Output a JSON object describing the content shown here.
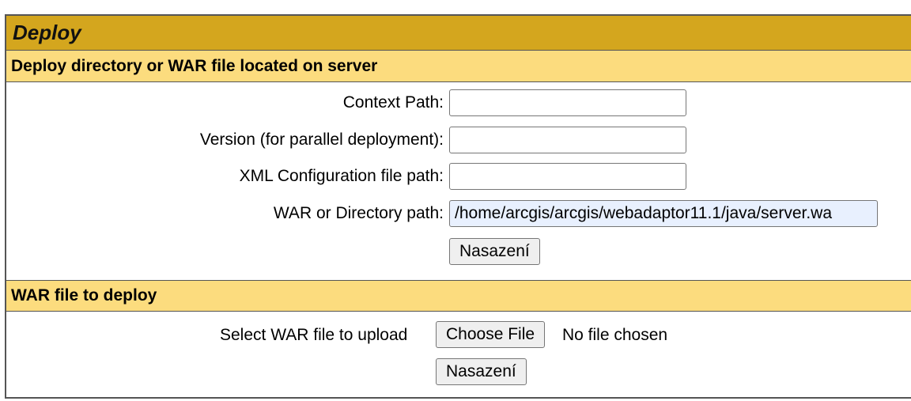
{
  "panel": {
    "title": "Deploy"
  },
  "server_deploy": {
    "header": "Deploy directory or WAR file located on server",
    "context_path": {
      "label": "Context Path:",
      "value": ""
    },
    "version": {
      "label": "Version (for parallel deployment):",
      "value": ""
    },
    "xml_config": {
      "label": "XML Configuration file path:",
      "value": ""
    },
    "war_path": {
      "label": "WAR or Directory path:",
      "value": "/home/arcgis/arcgis/webadaptor11.1/java/server.wa"
    },
    "deploy_button": "Nasazení"
  },
  "war_upload": {
    "header": "WAR file to deploy",
    "select_label": "Select WAR file to upload",
    "choose_button": "Choose File",
    "file_status": "No file chosen",
    "deploy_button": "Nasazení"
  }
}
